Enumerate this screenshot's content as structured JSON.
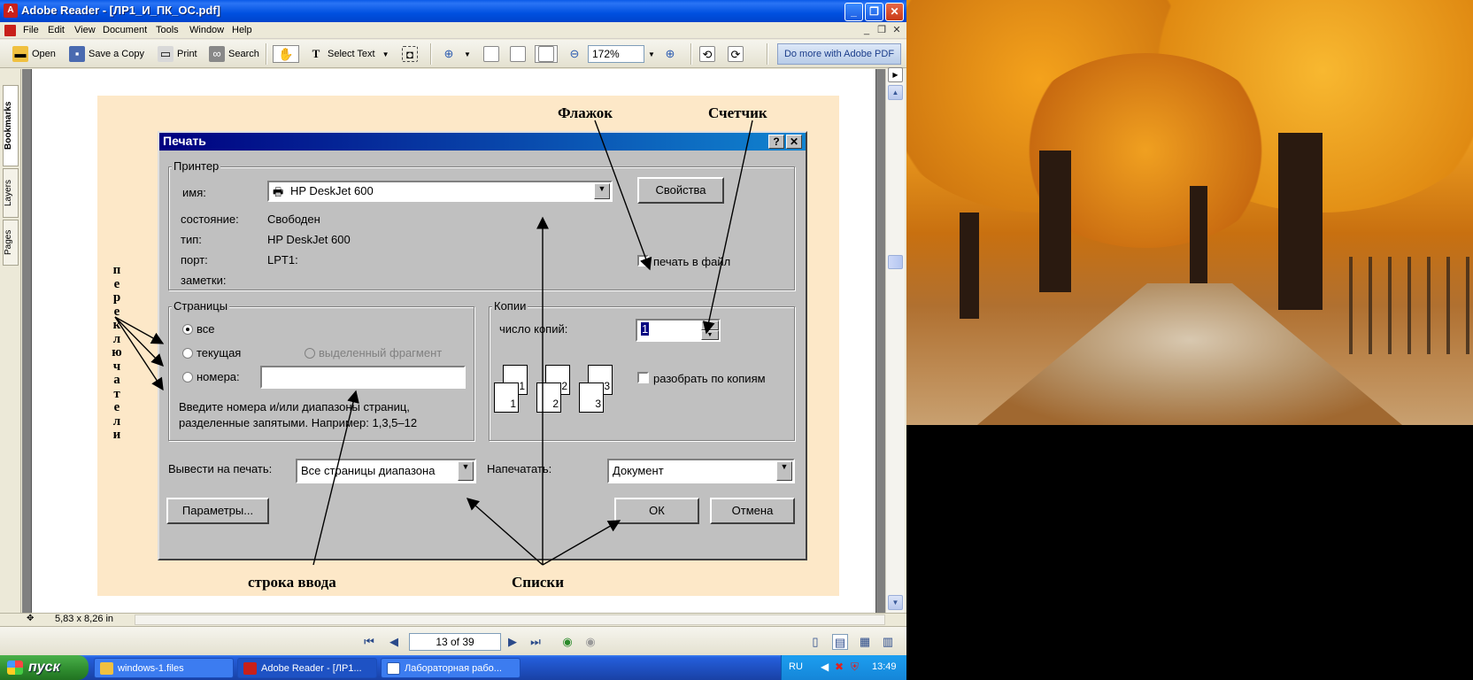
{
  "window": {
    "title": "Adobe Reader - [ЛР1_И_ПК_ОС.pdf]",
    "min_label": "_",
    "max_label": "❐",
    "close_label": "✕"
  },
  "menu": {
    "items": [
      "File",
      "Edit",
      "View",
      "Document",
      "Tools",
      "Window",
      "Help"
    ]
  },
  "toolbar": {
    "open": "Open",
    "save_copy": "Save a Copy",
    "print": "Print",
    "search": "Search",
    "select_text": "Select Text",
    "zoom": "172%",
    "promo": "Do more with Adobe PDF"
  },
  "nav_tabs": [
    "Bookmarks",
    "Layers",
    "Pages"
  ],
  "status": {
    "page_size": "5,83 x 8,26 in",
    "page_indicator": "13 of 39"
  },
  "slide": {
    "annot_flag": "Флажок",
    "annot_counter": "Счетчик",
    "annot_input": "строка ввода",
    "annot_lists": "Списки",
    "annot_switches_letters": [
      "п",
      "е",
      "р",
      "е",
      "к",
      "л",
      "ю",
      "ч",
      "а",
      "т",
      "е",
      "л",
      "и"
    ]
  },
  "print_dialog": {
    "title": "Печать",
    "help_btn": "?",
    "close_btn": "✕",
    "printer_group": "Принтер",
    "name_label": "имя:",
    "printer_name": "HP DeskJet 600",
    "properties_btn": "Свойства",
    "status_label": "состояние:",
    "status_value": "Свободен",
    "type_label": "тип:",
    "type_value": "HP DeskJet 600",
    "port_label": "порт:",
    "port_value": "LPT1:",
    "notes_label": "заметки:",
    "print_to_file": "печать в файл",
    "pages_group": "Страницы",
    "radio_all": "все",
    "radio_current": "текущая",
    "radio_selection": "выделенный фрагмент",
    "radio_pages": "номера:",
    "pages_hint_1": "Введите номера и/или диапазоны страниц,",
    "pages_hint_2": "разделенные запятыми. Например: 1,3,5–12",
    "copies_group": "Копии",
    "copies_label": "число копий:",
    "copies_value": "1",
    "collate": "разобрать по копиям",
    "print_range_label": "Вывести на печать:",
    "print_range_value": "Все страницы диапазона",
    "print_what_label": "Напечатать:",
    "print_what_value": "Документ",
    "options_btn": "Параметры...",
    "ok_btn": "ОК",
    "cancel_btn": "Отмена",
    "collate_icons": [
      "1",
      "1",
      "2",
      "2",
      "3",
      "3"
    ]
  },
  "taskbar": {
    "start": "пуск",
    "tasks": [
      "windows-1.files",
      "Adobe Reader - [ЛР1...",
      "Лабораторная рабо..."
    ],
    "lang": "RU",
    "time": "13:49"
  }
}
